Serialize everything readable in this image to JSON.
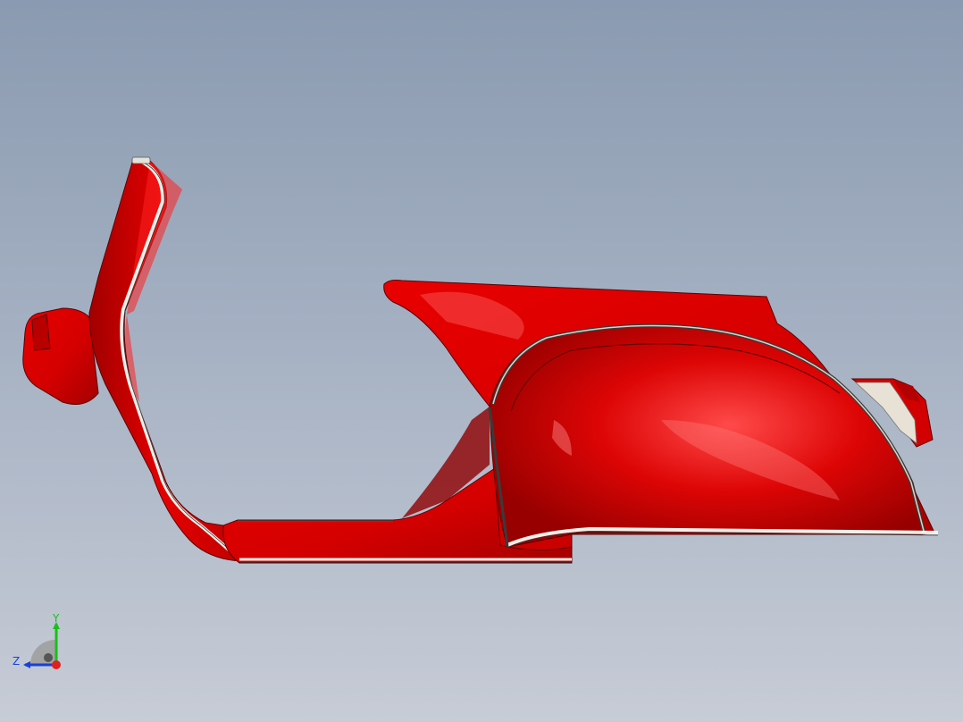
{
  "scene": {
    "model_name": "scooter-body-shell",
    "colors": {
      "body": "#dd0000",
      "body_shadow": "#9a0000",
      "body_highlight": "#ff5a5a",
      "trim": "#f2f0ea",
      "edge": "#4a0a0a",
      "background_top": "#8a9ab0",
      "background_bottom": "#c7ccd6"
    }
  },
  "triad": {
    "y_label": "Y",
    "z_label": "Z",
    "colors": {
      "x": "#e02020",
      "y": "#18c018",
      "z": "#1a3fd8"
    }
  }
}
